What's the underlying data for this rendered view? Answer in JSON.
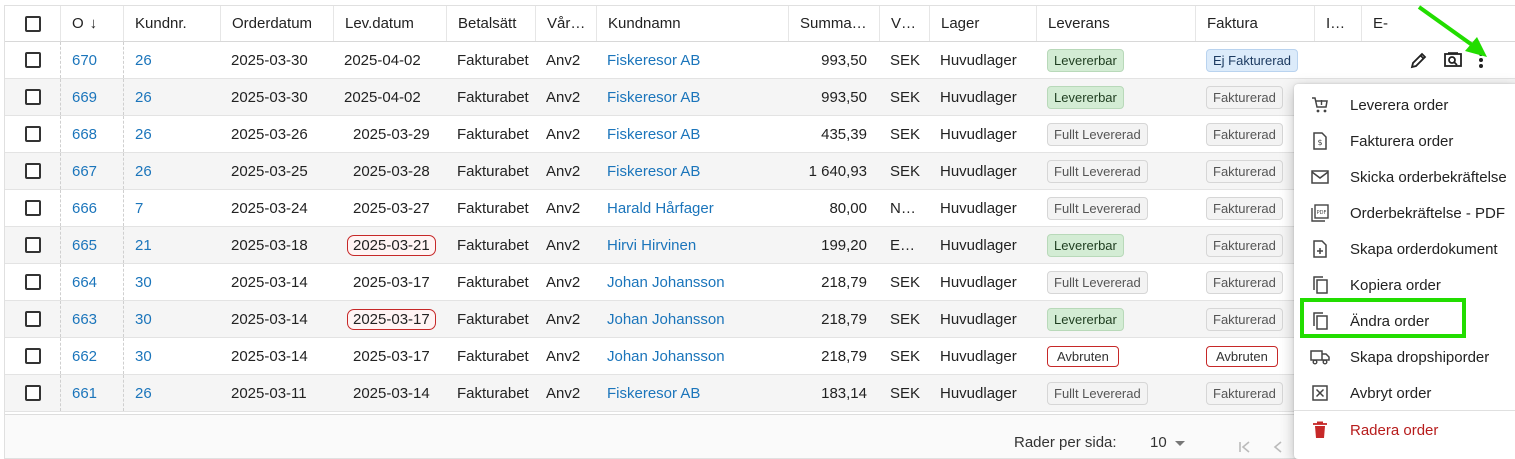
{
  "columns": {
    "onr": "O",
    "knr": "Kundnr.",
    "odat": "Orderdatum",
    "ldat": "Lev.datum",
    "bet": "Betalsätt",
    "var": "Vår…",
    "kname": "Kundnamn",
    "sum": "Summa…",
    "val": "V…",
    "lag": "Lager",
    "lev": "Leverans",
    "fak": "Faktura",
    "i": "I…",
    "e": "E-"
  },
  "rows": [
    {
      "onr": "670",
      "knr": "26",
      "odat": "2025-03-30",
      "ldat": "2025-04-02",
      "bet": "Fakturabet",
      "var": "Anv2",
      "kname": "Fiskeresor AB",
      "sum": "993,50",
      "val": "SEK",
      "lag": "Huvudlager",
      "lev": "Levererbar",
      "fak": "Ej Fakturerad"
    },
    {
      "onr": "669",
      "knr": "26",
      "odat": "2025-03-30",
      "ldat": "2025-04-02",
      "bet": "Fakturabet",
      "var": "Anv2",
      "kname": "Fiskeresor AB",
      "sum": "993,50",
      "val": "SEK",
      "lag": "Huvudlager",
      "lev": "Levererbar",
      "fak": "Fakturerad"
    },
    {
      "onr": "668",
      "knr": "26",
      "odat": "2025-03-26",
      "ldat": "2025-03-29",
      "bet": "Fakturabet",
      "var": "Anv2",
      "kname": "Fiskeresor AB",
      "sum": "435,39",
      "val": "SEK",
      "lag": "Huvudlager",
      "lev": "Fullt Levererad",
      "fak": "Fakturerad"
    },
    {
      "onr": "667",
      "knr": "26",
      "odat": "2025-03-25",
      "ldat": "2025-03-28",
      "bet": "Fakturabet",
      "var": "Anv2",
      "kname": "Fiskeresor AB",
      "sum": "1 640,93",
      "val": "SEK",
      "lag": "Huvudlager",
      "lev": "Fullt Levererad",
      "fak": "Fakturerad"
    },
    {
      "onr": "666",
      "knr": "7",
      "odat": "2025-03-24",
      "ldat": "2025-03-27",
      "bet": "Fakturabet",
      "var": "Anv2",
      "kname": "Harald Hårfager",
      "sum": "80,00",
      "val": "N…",
      "lag": "Huvudlager",
      "lev": "Fullt Levererad",
      "fak": "Fakturerad"
    },
    {
      "onr": "665",
      "knr": "21",
      "odat": "2025-03-18",
      "ldat": "2025-03-21",
      "bet": "Fakturabet",
      "var": "Anv2",
      "kname": "Hirvi Hirvinen",
      "sum": "199,20",
      "val": "E…",
      "lag": "Huvudlager",
      "lev": "Levererbar",
      "fak": "Fakturerad"
    },
    {
      "onr": "664",
      "knr": "30",
      "odat": "2025-03-14",
      "ldat": "2025-03-17",
      "bet": "Fakturabet",
      "var": "Anv2",
      "kname": "Johan Johansson",
      "sum": "218,79",
      "val": "SEK",
      "lag": "Huvudlager",
      "lev": "Fullt Levererad",
      "fak": "Fakturerad"
    },
    {
      "onr": "663",
      "knr": "30",
      "odat": "2025-03-14",
      "ldat": "2025-03-17",
      "bet": "Fakturabet",
      "var": "Anv2",
      "kname": "Johan Johansson",
      "sum": "218,79",
      "val": "SEK",
      "lag": "Huvudlager",
      "lev": "Levererbar",
      "fak": "Fakturerad"
    },
    {
      "onr": "662",
      "knr": "30",
      "odat": "2025-03-14",
      "ldat": "2025-03-17",
      "bet": "Fakturabet",
      "var": "Anv2",
      "kname": "Johan Johansson",
      "sum": "218,79",
      "val": "SEK",
      "lag": "Huvudlager",
      "lev": "Avbruten",
      "fak": "Avbruten"
    },
    {
      "onr": "661",
      "knr": "26",
      "odat": "2025-03-11",
      "ldat": "2025-03-14",
      "bet": "Fakturabet",
      "var": "Anv2",
      "kname": "Fiskeresor AB",
      "sum": "183,14",
      "val": "SEK",
      "lag": "Huvudlager",
      "lev": "Fullt Levererad",
      "fak": "Fakturerad"
    }
  ],
  "pagination": {
    "rows_per_page_label": "Rader per sida:",
    "rows_per_page_value": "10"
  },
  "menu": {
    "items": [
      {
        "label": "Leverera order",
        "icon": "cart-icon"
      },
      {
        "label": "Fakturera order",
        "icon": "invoice-icon"
      },
      {
        "label": "Skicka orderbekräftelse",
        "icon": "mail-icon"
      },
      {
        "label": "Orderbekräftelse - PDF",
        "icon": "pdf-icon"
      },
      {
        "label": "Skapa orderdokument",
        "icon": "document-add-icon"
      },
      {
        "label": "Kopiera order",
        "icon": "copy-icon"
      },
      {
        "label": "Ändra order",
        "icon": "copy-icon"
      },
      {
        "label": "Skapa dropshiporder",
        "icon": "truck-icon"
      },
      {
        "label": "Avbryt order",
        "icon": "cancel-box-icon"
      },
      {
        "label": "Radera order",
        "icon": "trash-icon"
      }
    ]
  },
  "colors": {
    "link": "#1b75bb",
    "highlight": "#22dd00",
    "danger": "#b71c1c",
    "badge_green": "#d3ecd4",
    "badge_blue": "#dcebfa"
  }
}
